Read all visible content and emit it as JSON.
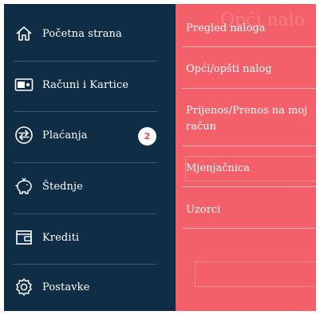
{
  "sidebar": {
    "items": [
      {
        "label": "Početna strana",
        "icon": "home-icon"
      },
      {
        "label": "Računi i Kartice",
        "icon": "card-icon"
      },
      {
        "label": "Plaćanja",
        "icon": "exchange-icon",
        "badge": "2"
      },
      {
        "label": "Štednje",
        "icon": "piggy-bank-icon"
      },
      {
        "label": "Krediti",
        "icon": "wallet-icon"
      },
      {
        "label": "Postavke",
        "icon": "gear-icon"
      }
    ]
  },
  "submenu": {
    "items": [
      {
        "label": "Pregled naloga"
      },
      {
        "label": "Opći/opšti nalog"
      },
      {
        "label": "Prijenos/Prenos na moj račun"
      },
      {
        "label": "Mjenjačnica"
      },
      {
        "label": "Uzorci"
      }
    ]
  },
  "colors": {
    "sidebar_bg": "#0f2e46",
    "submenu_bg": "#f4606a",
    "badge_text": "#e6484f"
  }
}
